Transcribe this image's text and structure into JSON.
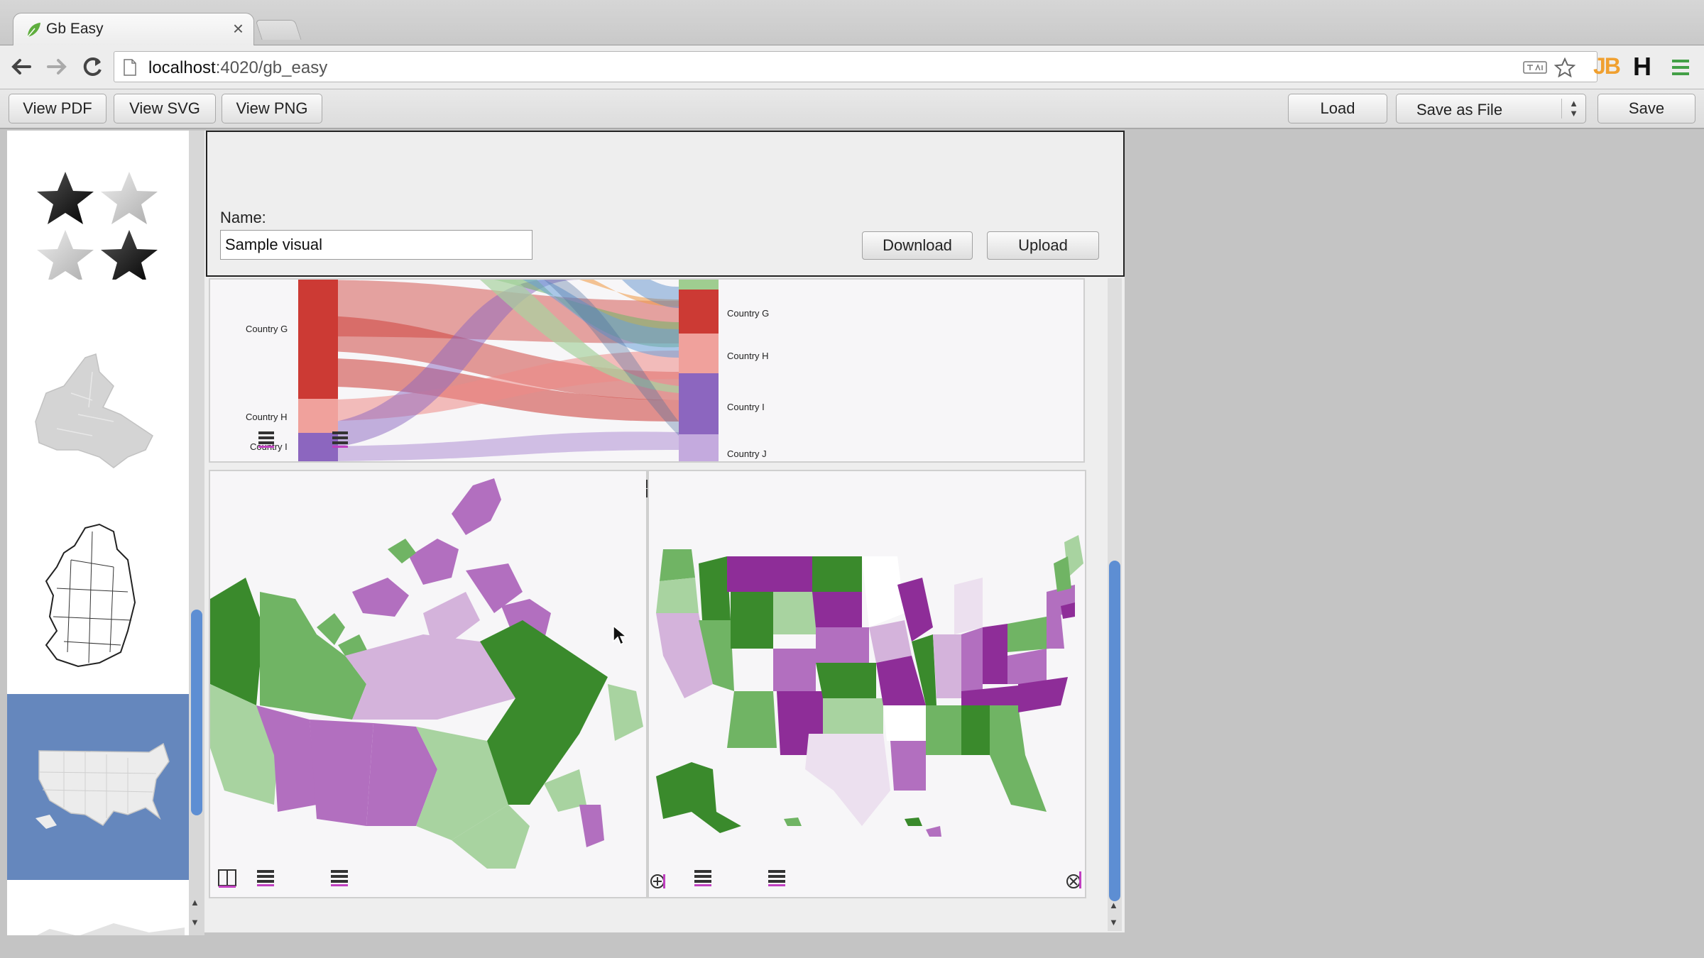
{
  "browser": {
    "tab_title": "Gb Easy",
    "tab_close": "×",
    "url_host": "localhost",
    "url_path": ":4020/gb_easy",
    "extension_jb": "JB",
    "extension_h": "H"
  },
  "toolbar": {
    "view_pdf": "View PDF",
    "view_svg": "View SVG",
    "view_png": "View PNG",
    "load": "Load",
    "save_as": "Save as File",
    "save": "Save"
  },
  "panel": {
    "name_label": "Name:",
    "name_value": "Sample visual",
    "download": "Download",
    "upload": "Upload"
  },
  "sidebar": {
    "items": [
      {
        "name": "stars",
        "selected": false
      },
      {
        "name": "canada-map",
        "selected": false
      },
      {
        "name": "ireland-map",
        "selected": false
      },
      {
        "name": "usa-map",
        "selected": true
      }
    ]
  },
  "sankey": {
    "left_labels": [
      "Country G",
      "Country H",
      "Country I"
    ],
    "right_labels": [
      "Country G",
      "Country H",
      "Country I",
      "Country J"
    ]
  },
  "colors": {
    "purple_dark": "#8e2d98",
    "purple_mid": "#b26fbf",
    "purple_light": "#d4b3db",
    "green_dark": "#3a8a2c",
    "green_mid": "#70b464",
    "green_light": "#a8d3a0",
    "sankey_red": "#cc3a34",
    "selected_blue": "#6587bd"
  },
  "icons": [
    "leaf-favicon",
    "back-arrow-icon",
    "forward-arrow-icon",
    "reload-icon",
    "page-icon",
    "translate-icon",
    "star-bookmark-icon",
    "menu-icon",
    "list-icon",
    "split-icon",
    "add-icon",
    "remove-icon",
    "cursor-icon"
  ]
}
